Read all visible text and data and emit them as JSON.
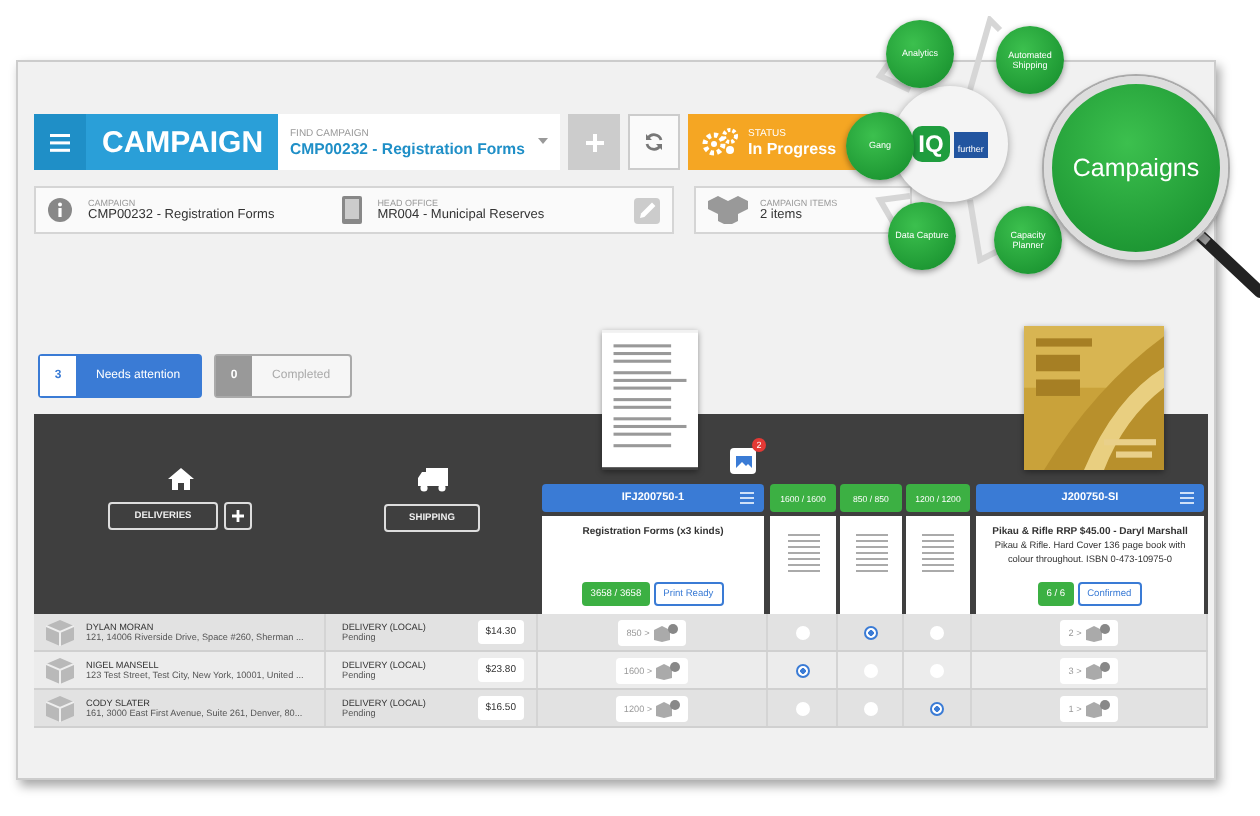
{
  "header": {
    "title": "CAMPAIGN",
    "find_campaign": {
      "label": "FIND CAMPAIGN",
      "value": "CMP00232 - Registration Forms"
    },
    "status": {
      "label": "STATUS",
      "value": "In Progress"
    }
  },
  "info": [
    {
      "kind": "info",
      "label": "CAMPAIGN",
      "value": "CMP00232 - Registration Forms"
    },
    {
      "kind": "office",
      "label": "HEAD OFFICE",
      "value": "MR004 - Municipal Reserves"
    },
    {
      "kind": "items",
      "label": "CAMPAIGN ITEMS",
      "value": "2 items"
    }
  ],
  "filters": [
    {
      "count": "3",
      "label": "Needs attention",
      "selected": true
    },
    {
      "count": "0",
      "label": "Completed",
      "selected": false
    }
  ],
  "columns": {
    "deliveries": "DELIVERIES",
    "shipping": "SHIPPING"
  },
  "items": [
    {
      "code": "IFJ200750-1",
      "badge": "2",
      "description": "Registration Forms (x3 kinds)",
      "quantity": "3658 / 3658",
      "status": "Print Ready",
      "variants": [
        {
          "quantity": "1600 / 1600"
        },
        {
          "quantity": "850 / 850"
        },
        {
          "quantity": "1200 / 1200"
        }
      ]
    },
    {
      "code": "J200750-SI",
      "description": "Pikau & Rifle RRP $45.00 - Daryl Marshall",
      "detail": "Pikau & Rifle. Hard Cover 136 page book with colour throughout. ISBN 0-473-10975-0",
      "quantity": "6 / 6",
      "status": "Confirmed"
    }
  ],
  "rows": [
    {
      "name": "DYLAN MORAN",
      "address": "121, 14006 Riverside Drive, Space #260, Sherman ...",
      "shipping": "DELIVERY (LOCAL)",
      "shipping_status": "Pending",
      "price": "$14.30",
      "item_quantity": "850 >",
      "variants": [
        {
          "selected": false
        },
        {
          "selected": true
        },
        {
          "selected": false
        }
      ],
      "book_quantity": "2 >"
    },
    {
      "name": "NIGEL MANSELL",
      "address": "123 Test Street, Test City, New York, 10001, United ...",
      "shipping": "DELIVERY (LOCAL)",
      "shipping_status": "Pending",
      "price": "$23.80",
      "item_quantity": "1600 >",
      "variants": [
        {
          "selected": true
        },
        {
          "selected": false
        },
        {
          "selected": false
        }
      ],
      "book_quantity": "3 >"
    },
    {
      "name": "CODY SLATER",
      "address": "161, 3000 East First Avenue, Suite 261, Denver, 80...",
      "shipping": "DELIVERY (LOCAL)",
      "shipping_status": "Pending",
      "price": "$16.50",
      "item_quantity": "1200 >",
      "variants": [
        {
          "selected": false
        },
        {
          "selected": false
        },
        {
          "selected": true
        }
      ],
      "book_quantity": "1 >"
    }
  ],
  "diagram": {
    "logo": "IQ",
    "logo_tag": "further",
    "focus": "Campaigns",
    "nodes": [
      {
        "label": "Analytics"
      },
      {
        "label": "Automated Shipping"
      },
      {
        "label": "Gang"
      },
      {
        "label": "Data Capture"
      },
      {
        "label": "Capacity Planner"
      }
    ]
  }
}
